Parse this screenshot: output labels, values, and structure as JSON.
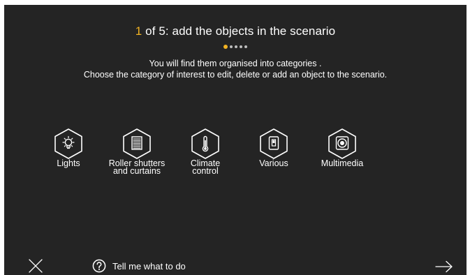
{
  "header": {
    "step_current": "1",
    "step_rest": " of 5: add the objects in the scenario",
    "total_steps": 5,
    "active_step": 1
  },
  "description": {
    "line1": "You will find them organised into categories .",
    "line2": "Choose the category of interest to edit, delete or add an object to the scenario."
  },
  "categories": [
    {
      "icon": "light-bulb-icon",
      "line1": "Lights",
      "line2": ""
    },
    {
      "icon": "roller-shutter-icon",
      "line1": "Roller shutters",
      "line2": "and curtains"
    },
    {
      "icon": "thermometer-icon",
      "line1": "Climate",
      "line2": "control"
    },
    {
      "icon": "switch-icon",
      "line1": "Various",
      "line2": ""
    },
    {
      "icon": "speaker-icon",
      "line1": "Multimedia",
      "line2": ""
    }
  ],
  "footer": {
    "close_icon": "close-icon",
    "help_icon": "question-circle-icon",
    "help_label": "Tell me what to do",
    "next_icon": "arrow-right-icon"
  },
  "colors": {
    "background": "#242424",
    "accent": "#f2b323",
    "text": "#ffffff"
  }
}
